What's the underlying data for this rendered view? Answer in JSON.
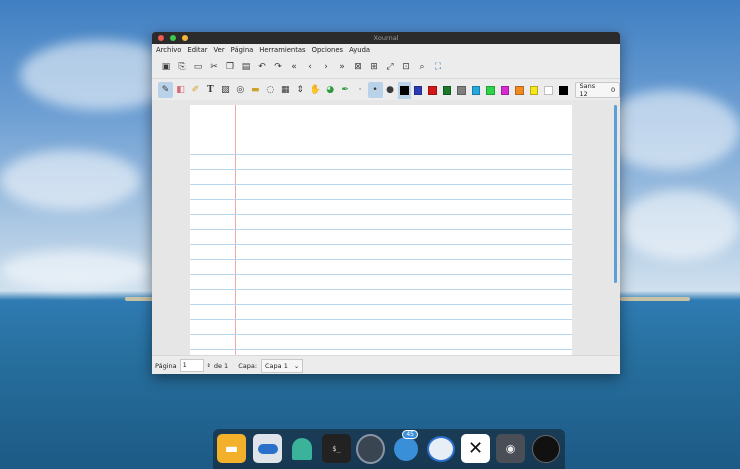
{
  "window": {
    "title": "Xournal"
  },
  "menu": [
    "Archivo",
    "Editar",
    "Ver",
    "Página",
    "Herramientas",
    "Opciones",
    "Ayuda"
  ],
  "toolbar1_icons": [
    "save-icon",
    "new-page-icon",
    "open-icon",
    "cut-icon",
    "copy-icon",
    "paste-icon",
    "undo-icon",
    "redo-icon",
    "first-page-icon",
    "prev-page-icon",
    "next-page-icon",
    "last-page-icon",
    "zoom-fit-icon",
    "zoom-page-icon",
    "zoom-width-icon",
    "zoom-out-icon",
    "zoom-in-icon",
    "fullscreen-icon"
  ],
  "toolbar2_tools": [
    "pen-icon",
    "eraser-icon",
    "highlighter-icon",
    "text-tool-icon",
    "image-tool-icon",
    "shape-recognizer-icon",
    "ruler-icon",
    "lasso-icon",
    "rect-select-icon",
    "vertical-space-icon",
    "hand-icon",
    "default-pen-icon",
    "shape-pen-icon"
  ],
  "colors": [
    "#000000",
    "#2b3bb5",
    "#d41616",
    "#1b7a2a",
    "#808080",
    "#24a8e0",
    "#2fd44a",
    "#d82bd6",
    "#f08b23",
    "#f5e61d",
    "#ffffff",
    "#000000"
  ],
  "font_button": {
    "font": "Sans 12",
    "value": "0"
  },
  "status": {
    "page_label": "Página",
    "page_value": "1",
    "of_label": "de 1",
    "layer_label": "Capa:",
    "layer_value": "Capa 1"
  },
  "dock_apps": [
    "files-icon",
    "settings-toggle-icon",
    "ghost-app-icon",
    "terminal-icon",
    "speaker-icon",
    "telegram-icon",
    "mail-icon",
    "close-x-app-icon",
    "screenshot-icon",
    "clock-icon"
  ],
  "dock_badge": "45"
}
